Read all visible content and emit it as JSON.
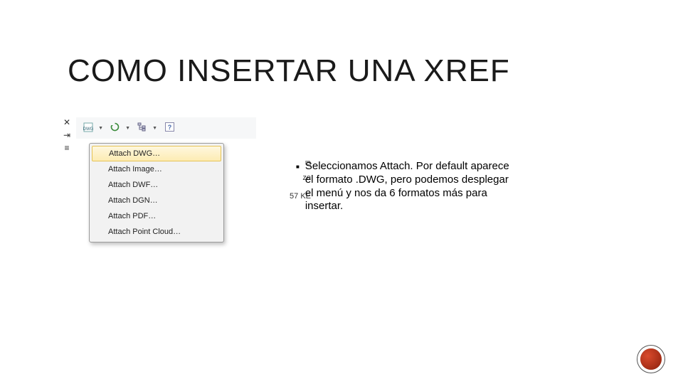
{
  "title": "COMO INSERTAR UNA XREF",
  "description": "Seleccionamos Attach. Por default aparece el formato .DWG, pero podemos desplegar el menú y nos da 6 formatos más para insertar.",
  "menu": {
    "items": [
      "Attach DWG…",
      "Attach Image…",
      "Attach DWF…",
      "Attach DGN…",
      "Attach PDF…",
      "Attach Point Cloud…"
    ],
    "highlighted_index": 0
  },
  "bg_rows": {
    "r1_icon_label": "⧉",
    "r2_label": "ze",
    "r3_label": "57 KE"
  },
  "toolbar_icons": {
    "attach": "attach-dwg-icon",
    "refresh": "refresh-icon",
    "tree": "tree-icon",
    "help": "help-icon"
  },
  "left_icons": {
    "close": "✕",
    "expand": "⇥",
    "list": "≡"
  }
}
